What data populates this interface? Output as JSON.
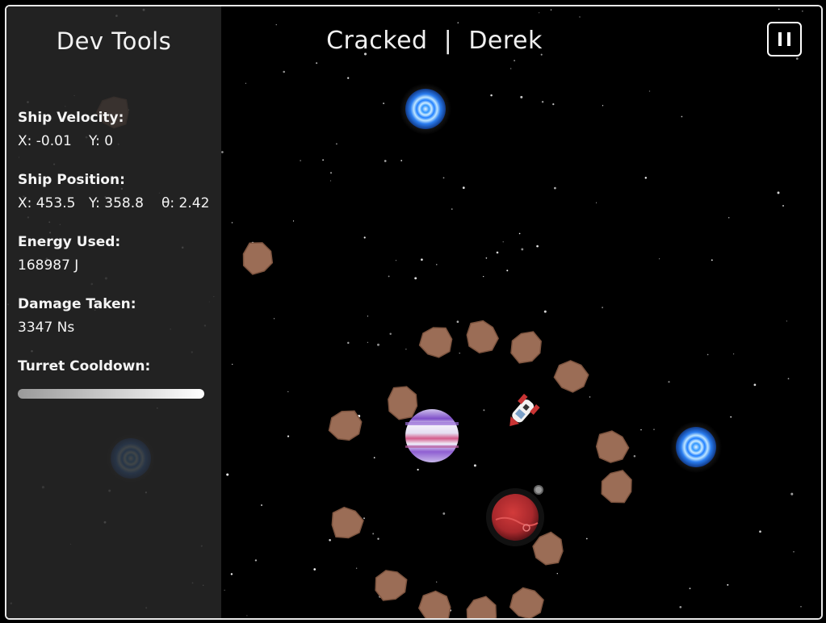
{
  "dev_tools": {
    "title": "Dev Tools",
    "velocity": {
      "label": "Ship Velocity:",
      "x": "X: -0.01",
      "y": "Y: 0"
    },
    "position": {
      "label": "Ship Position:",
      "x": "X: 453.5",
      "y": "Y: 358.8",
      "theta": "θ: 2.42"
    },
    "energy": {
      "label": "Energy Used:",
      "value": "168987 J"
    },
    "damage": {
      "label": "Damage Taken:",
      "value": "3347 Ns"
    },
    "cooldown": {
      "label": "Turret Cooldown:",
      "fill_fraction": 1.0
    }
  },
  "header": {
    "title": "Cracked  |  Derek"
  },
  "icons": {
    "pause": "pause-icon"
  },
  "colors": {
    "panel_bg": "#282828",
    "portal": "#2a8cff",
    "asteroid": "#9b6d56",
    "gas_planet": "#b89be6",
    "red_planet": "#b8312f",
    "frame_border": "#e9e9e9"
  }
}
